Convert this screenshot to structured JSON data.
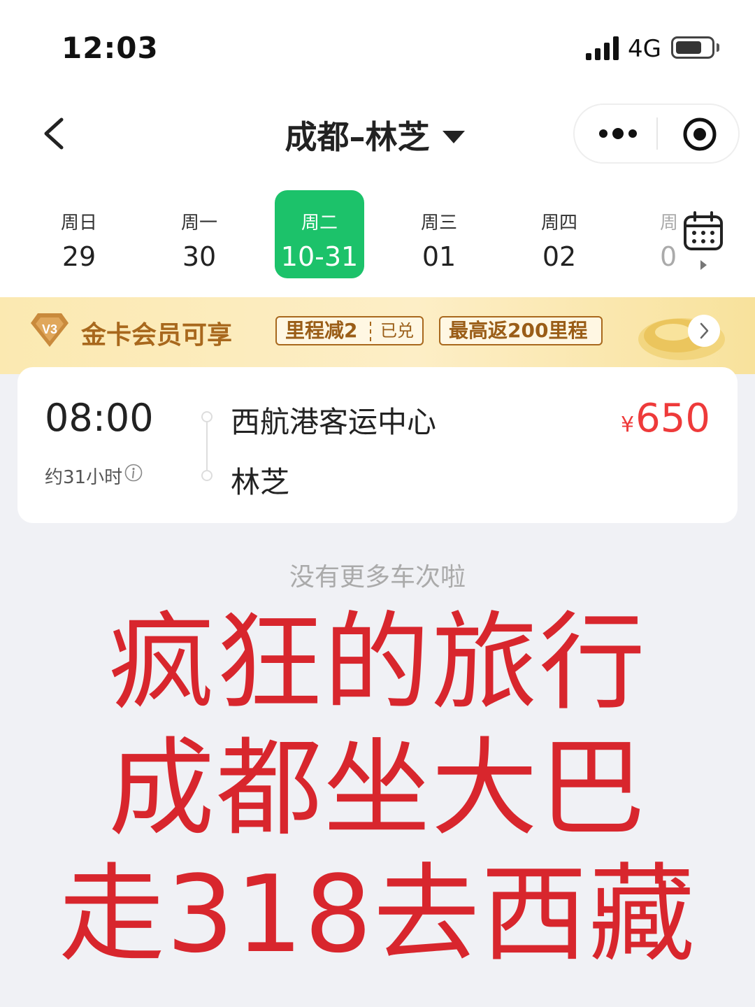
{
  "status_bar": {
    "time": "12:03",
    "network": "4G",
    "battery_level": 0.75,
    "icons": [
      "signal-icon",
      "battery-icon"
    ]
  },
  "header": {
    "title": "成都–林芝",
    "icons": [
      "back-icon",
      "dropdown-caret-icon",
      "more-icon",
      "target-icon"
    ]
  },
  "dates": [
    {
      "weekday": "周日",
      "date": "29",
      "selected": false
    },
    {
      "weekday": "周一",
      "date": "30",
      "selected": false
    },
    {
      "weekday": "周二",
      "date": "10-31",
      "selected": true
    },
    {
      "weekday": "周三",
      "date": "01",
      "selected": false
    },
    {
      "weekday": "周四",
      "date": "02",
      "selected": false
    },
    {
      "weekday": "周",
      "date": "0",
      "selected": false
    }
  ],
  "calendar_icon": "calendar-icon",
  "banner": {
    "badge": "V3",
    "text": "金卡会员可享",
    "tag1_main": "里程减2",
    "tag1_sub": "已兑",
    "tag2": "最高返200里程",
    "arrow": "›",
    "colors": {
      "gold_text": "#a8681d",
      "background": "#fbe9b1"
    }
  },
  "ticket": {
    "departure_time": "08:00",
    "duration": "约31小时",
    "from": "西航港客运中心",
    "to": "林芝",
    "currency": "¥",
    "price": "650",
    "price_color": "#ee3a3a"
  },
  "no_more_text": "没有更多车次啦",
  "overlay": {
    "line1": "疯狂的旅行",
    "line2": "成都坐大巴",
    "line3": "走318去西藏",
    "color": "#d8262d"
  },
  "accent_color": "#1cc26a"
}
